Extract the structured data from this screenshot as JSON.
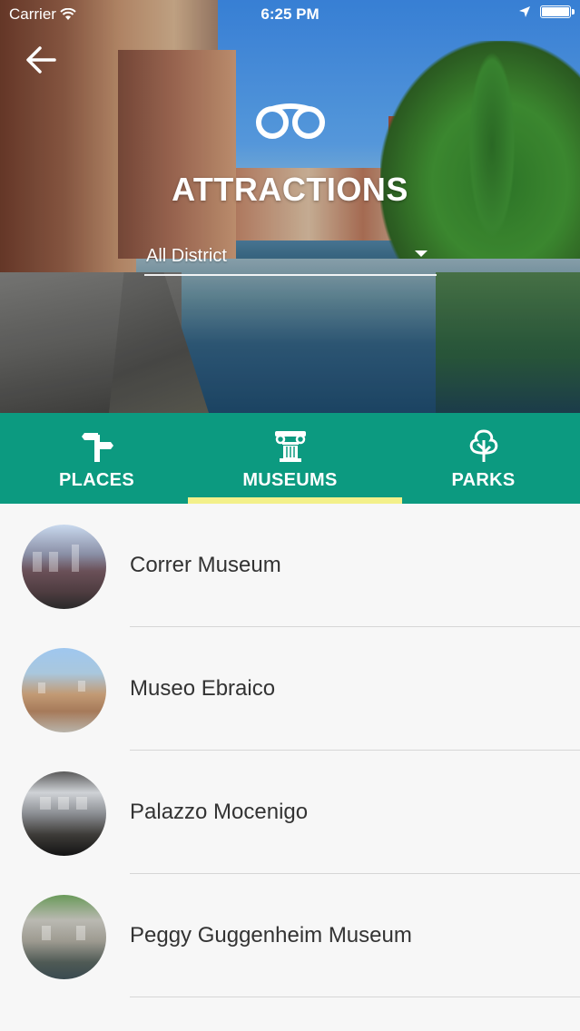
{
  "status_bar": {
    "carrier": "Carrier",
    "time": "6:25 PM"
  },
  "header": {
    "title": "ATTRACTIONS",
    "icon": "binoculars-icon",
    "district_selector": {
      "value": "All District"
    }
  },
  "tabs": [
    {
      "label": "PLACES",
      "icon": "signpost-icon",
      "selected": false
    },
    {
      "label": "MUSEUMS",
      "icon": "column-icon",
      "selected": true
    },
    {
      "label": "PARKS",
      "icon": "tree-icon",
      "selected": false
    }
  ],
  "museums": [
    {
      "name": "Correr Museum"
    },
    {
      "name": "Museo Ebraico"
    },
    {
      "name": "Palazzo Mocenigo"
    },
    {
      "name": "Peggy Guggenheim Museum"
    }
  ],
  "colors": {
    "tab_bar": "#0c9a80",
    "tab_indicator": "#f3f08a",
    "list_background": "#f7f7f7",
    "text_dark": "#333333"
  }
}
